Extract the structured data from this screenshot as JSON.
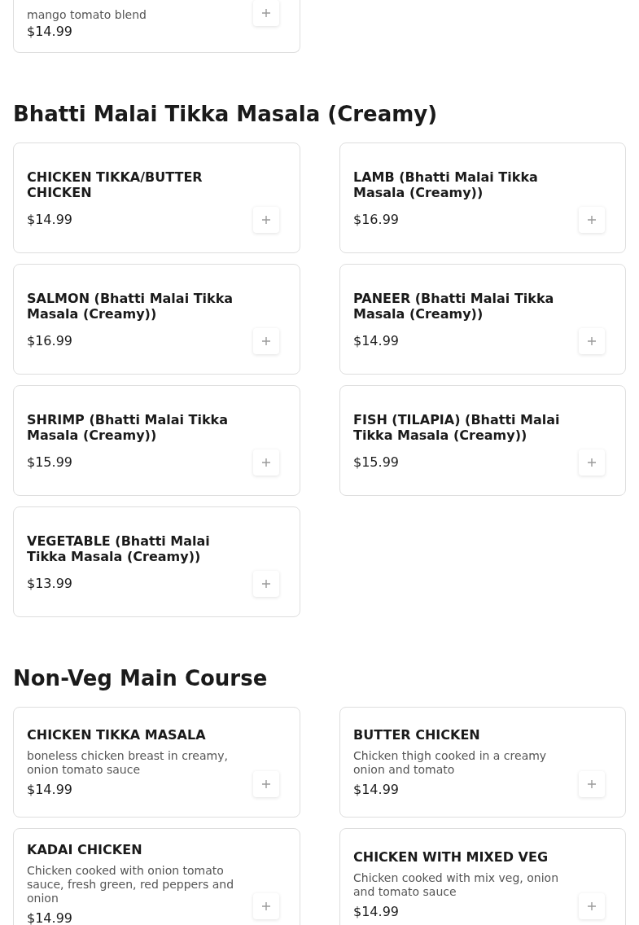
{
  "partial_item": {
    "description": "mango tomato blend",
    "price": "$14.99"
  },
  "sections": [
    {
      "title": "Bhatti Malai Tikka Masala (Creamy)",
      "items": [
        {
          "name": "CHICKEN TIKKA/BUTTER CHICKEN",
          "price": "$14.99"
        },
        {
          "name": "LAMB (Bhatti Malai Tikka Masala (Creamy))",
          "price": "$16.99"
        },
        {
          "name": "SALMON (Bhatti Malai Tikka Masala (Creamy))",
          "price": "$16.99"
        },
        {
          "name": "PANEER (Bhatti Malai Tikka Masala (Creamy))",
          "price": "$14.99"
        },
        {
          "name": "SHRIMP (Bhatti Malai Tikka Masala (Creamy))",
          "price": "$15.99"
        },
        {
          "name": "FISH (TILAPIA) (Bhatti Malai Tikka Masala (Creamy))",
          "price": "$15.99"
        },
        {
          "name": "VEGETABLE (Bhatti Malai Tikka Masala (Creamy))",
          "price": "$13.99"
        }
      ]
    },
    {
      "title": "Non-Veg Main Course",
      "items": [
        {
          "name": "CHICKEN TIKKA MASALA",
          "description": "boneless chicken breast in creamy, onion tomato sauce",
          "price": "$14.99"
        },
        {
          "name": "BUTTER CHICKEN",
          "description": "Chicken thigh cooked in a creamy onion and tomato",
          "price": "$14.99"
        },
        {
          "name": "KADAI CHICKEN",
          "description": "Chicken cooked with onion tomato sauce, fresh green, red peppers and onion",
          "price": "$14.99"
        },
        {
          "name": "CHICKEN WITH MIXED VEG",
          "description": "Chicken cooked with mix veg, onion and tomato sauce",
          "price": "$14.99"
        }
      ]
    }
  ]
}
